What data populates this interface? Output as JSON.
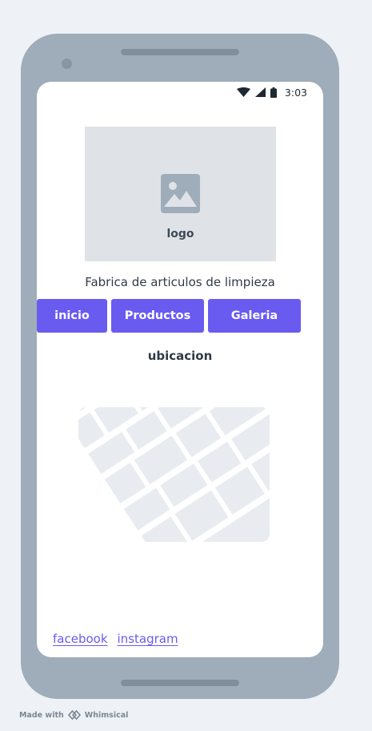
{
  "status_bar": {
    "time": "3:03",
    "icons": [
      "wifi-icon",
      "signal-icon",
      "battery-icon"
    ]
  },
  "logo": {
    "label": "logo",
    "icon": "image-placeholder-icon"
  },
  "tagline": "Fabrica de articulos de limpieza",
  "nav": {
    "inicio": "inicio",
    "productos": "Productos",
    "galeria": "Galeria"
  },
  "location_heading": "ubicacion",
  "map": {
    "icon": "map-placeholder"
  },
  "social_links": {
    "facebook": "facebook",
    "instagram": "instagram"
  },
  "footer_credit": {
    "prefix": "Made with",
    "brand": "Whimsical"
  },
  "colors": {
    "accent": "#6a5bf0",
    "device": "#9eadb9",
    "placeholder": "#dfe3e8"
  }
}
